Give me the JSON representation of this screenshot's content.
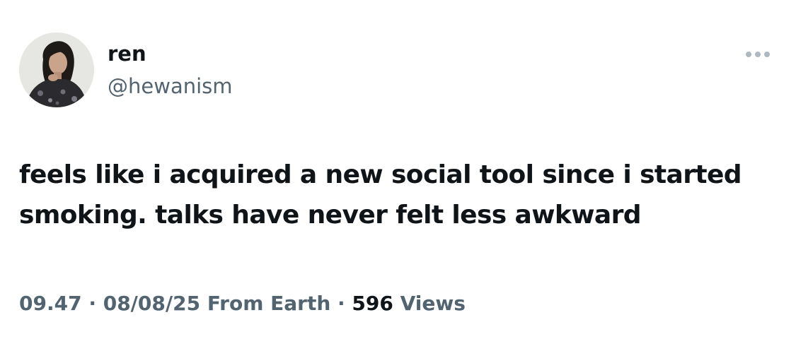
{
  "author": {
    "display_name": "ren",
    "handle": "@hewanism",
    "avatar_icon": "profile-photo"
  },
  "more_icon": "ellipsis-icon",
  "tweet": {
    "text": "feels like i acquired a new social tool since i started smoking. talks have never felt less awkward"
  },
  "meta": {
    "time": "09.47",
    "separator": "·",
    "date": "08/08/25",
    "source": "From Earth",
    "views_count": "596",
    "views_label": "Views"
  },
  "colors": {
    "text_primary": "#0f1419",
    "text_secondary": "#536471",
    "more_icon": "#aeb8c0",
    "background": "#ffffff"
  }
}
